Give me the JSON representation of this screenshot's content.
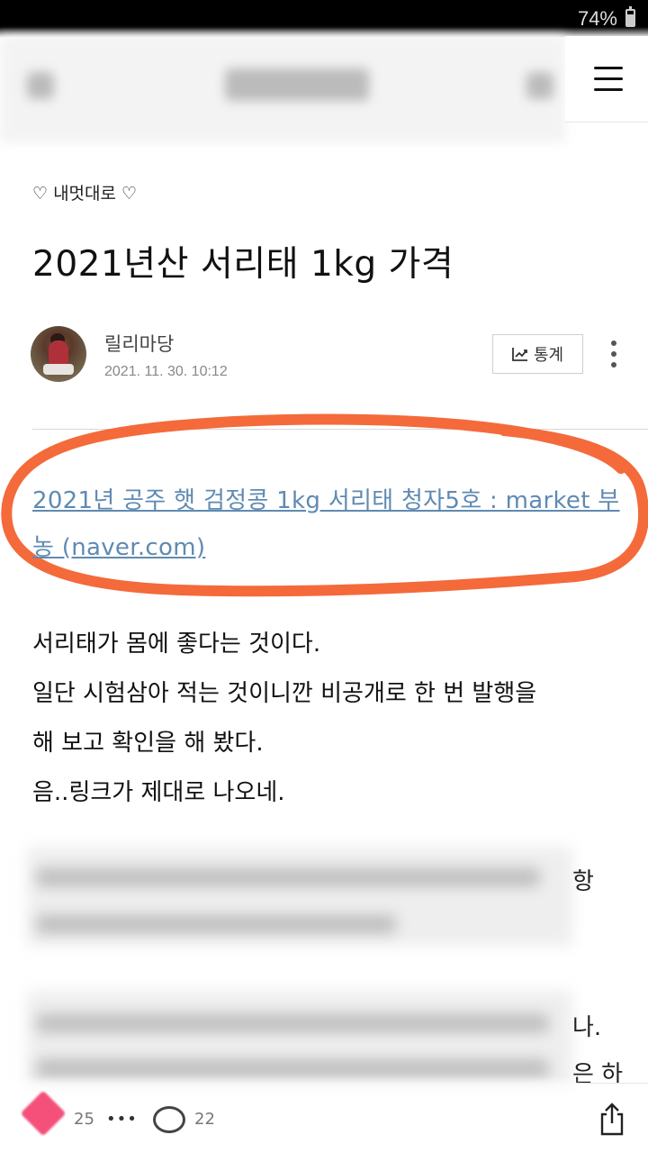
{
  "status_bar": {
    "battery": "74%",
    "battery_level": 0.74
  },
  "header": {
    "menu_icon": "hamburger-menu-icon"
  },
  "post": {
    "category": "♡ 내멋대로 ♡",
    "title": "2021년산 서리태 1kg 가격",
    "author": "릴리마당",
    "date": "2021. 11. 30. 10:12",
    "stats_label": "통계",
    "link_text": "2021년 공주 햇 검정콩 1kg 서리태 청자5호 : market 부농 (naver.com)",
    "paragraphs": [
      "서리태가 몸에 좋다는 것이다.",
      "일단 시험삼아 적는 것이니깐 비공개로 한 번 발행을",
      "해 보고 확인을 해 봤다.",
      "음..링크가 제대로 나오네."
    ],
    "edge_fragments": [
      "항",
      "나.",
      "은 하"
    ]
  },
  "footer": {
    "like_count": "25",
    "more": "•••",
    "comment_count": "22"
  },
  "colors": {
    "link": "#5f8ab2",
    "highlight": "#f46a3a",
    "like": "#f5507a"
  }
}
